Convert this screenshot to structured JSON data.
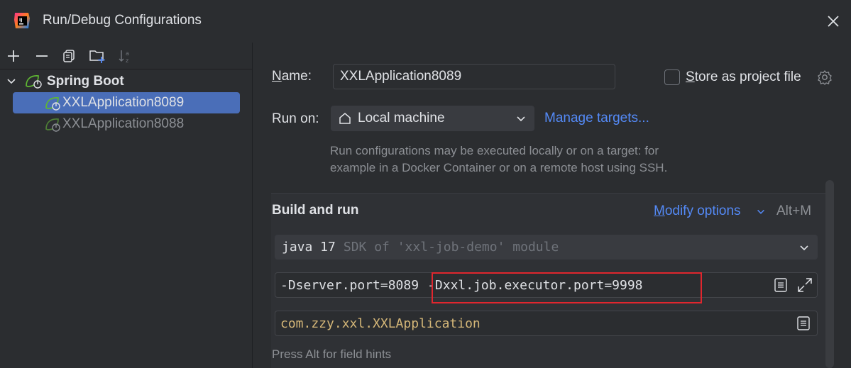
{
  "window": {
    "title": "Run/Debug Configurations"
  },
  "toolbar": {
    "buttons": [
      "add-icon",
      "remove-icon",
      "copy-icon",
      "new-folder-icon",
      "sort-icon"
    ]
  },
  "tree": {
    "group_label": "Spring Boot",
    "items": [
      {
        "label": "XXLApplication8089",
        "selected": true
      },
      {
        "label": "XXLApplication8088",
        "selected": false
      }
    ]
  },
  "form": {
    "name_label": "Name:",
    "name_value": "XXLApplication8089",
    "store_label": "Store as project file",
    "store_checked": false,
    "run_on_label": "Run on:",
    "run_on_value": "Local machine",
    "manage_targets": "Manage targets...",
    "hint_line1": "Run configurations may be executed locally or on a target: for",
    "hint_line2": "example in a Docker Container or on a remote host using SSH.",
    "build_and_run": "Build and run",
    "modify_options": "Modify options",
    "modify_shortcut": "Alt+M",
    "sdk_java": "java 17",
    "sdk_desc": "SDK of 'xxl-job-demo' module",
    "vm_options_part1": "-Dserver.port=8089",
    "vm_options_part2": "-Dxxl.job.executor.port=9998",
    "main_class": "com.zzy.xxl.XXLApplication",
    "field_hint": "Press Alt for field hints"
  },
  "colors": {
    "background": "#2b2d30",
    "accent_link": "#548af7",
    "selection": "#4a6eb8",
    "highlight_box": "#e0262e",
    "main_class_text": "#d5b778"
  }
}
